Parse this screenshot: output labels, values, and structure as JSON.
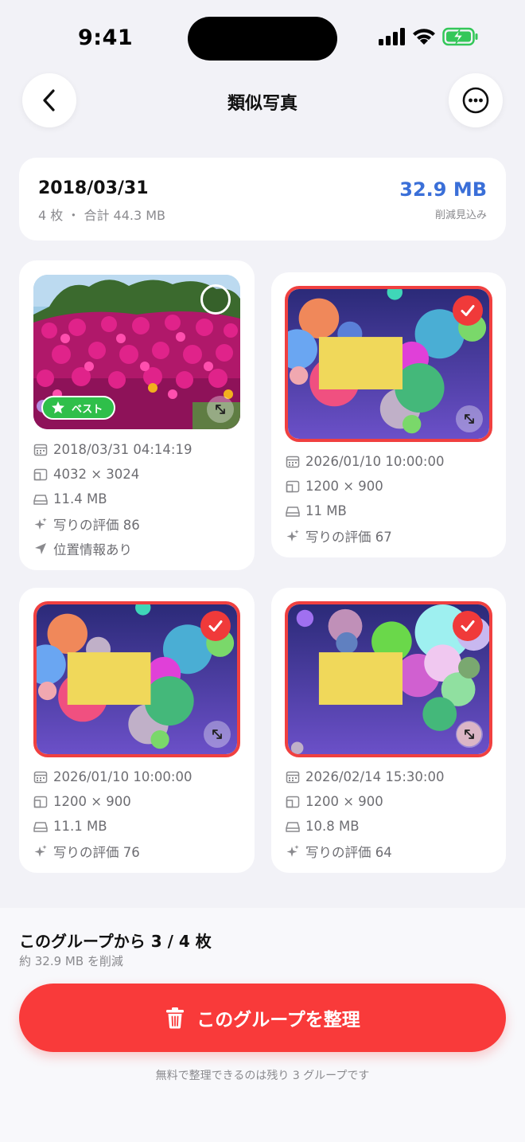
{
  "status_bar": {
    "time": "9:41"
  },
  "nav": {
    "title": "類似写真"
  },
  "summary": {
    "date": "2018/03/31",
    "meta": "4 枚 ・ 合計 44.3 MB",
    "savings": "32.9 MB",
    "savings_label": "削減見込み"
  },
  "photos": [
    {
      "best_label": "ベスト",
      "datetime": "2018/03/31 04:14:19",
      "dimensions": "4032 × 3024",
      "size": "11.4 MB",
      "score": "写りの評価 86",
      "location": "位置情報あり",
      "selected": false
    },
    {
      "datetime": "2026/01/10 10:00:00",
      "dimensions": "1200 × 900",
      "size": "11 MB",
      "score": "写りの評価 67",
      "selected": true
    },
    {
      "datetime": "2026/01/10 10:00:00",
      "dimensions": "1200 × 900",
      "size": "11.1 MB",
      "score": "写りの評価 76",
      "selected": true
    },
    {
      "datetime": "2026/02/14 15:30:00",
      "dimensions": "1200 × 900",
      "size": "10.8 MB",
      "score": "写りの評価 64",
      "selected": true
    }
  ],
  "bottom": {
    "title": "このグループから 3 / 4 枚",
    "subtitle": "約 32.9 MB を削減",
    "button_label": "このグループを整理",
    "note": "無料で整理できるのは残り 3 グループです"
  },
  "colors": {
    "accent_red": "#f93a3a",
    "accent_blue": "#3a6fd8",
    "best_green": "#2fbf4a"
  },
  "icons": [
    "back-chevron-icon",
    "more-icon",
    "calendar-icon",
    "dimensions-icon",
    "storage-icon",
    "sparkles-icon",
    "location-arrow-icon",
    "checkmark-icon",
    "expand-icon",
    "star-icon",
    "trash-icon"
  ]
}
